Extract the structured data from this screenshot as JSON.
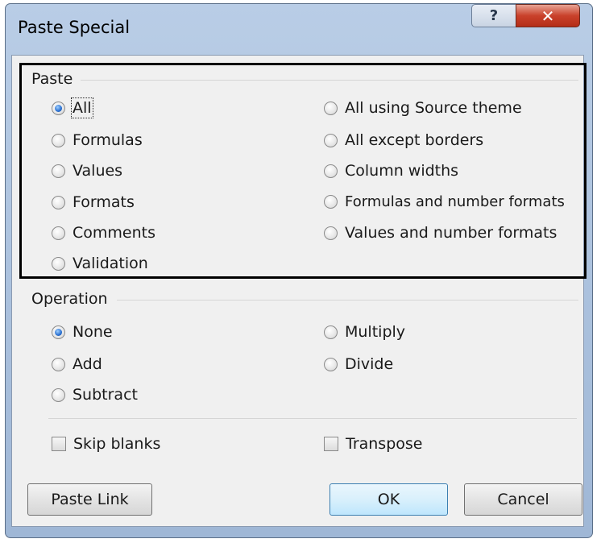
{
  "window": {
    "title": "Paste Special",
    "help_glyph": "?",
    "close_glyph": "✕"
  },
  "paste": {
    "label": "Paste",
    "options": [
      {
        "label": "All",
        "selected": true
      },
      {
        "label": "Formulas",
        "selected": false
      },
      {
        "label": "Values",
        "selected": false
      },
      {
        "label": "Formats",
        "selected": false
      },
      {
        "label": "Comments",
        "selected": false
      },
      {
        "label": "Validation",
        "selected": false
      },
      {
        "label": "All using Source theme",
        "selected": false
      },
      {
        "label": "All except borders",
        "selected": false
      },
      {
        "label": "Column widths",
        "selected": false
      },
      {
        "label": "Formulas and number formats",
        "selected": false
      },
      {
        "label": "Values and number formats",
        "selected": false
      }
    ]
  },
  "operation": {
    "label": "Operation",
    "options": [
      {
        "label": "None",
        "selected": true
      },
      {
        "label": "Add",
        "selected": false
      },
      {
        "label": "Subtract",
        "selected": false
      },
      {
        "label": "Multiply",
        "selected": false
      },
      {
        "label": "Divide",
        "selected": false
      }
    ]
  },
  "checkboxes": {
    "skip_blanks": {
      "label": "Skip blanks",
      "checked": false
    },
    "transpose": {
      "label": "Transpose",
      "checked": false
    }
  },
  "buttons": {
    "paste_link": "Paste Link",
    "ok": "OK",
    "cancel": "Cancel"
  }
}
